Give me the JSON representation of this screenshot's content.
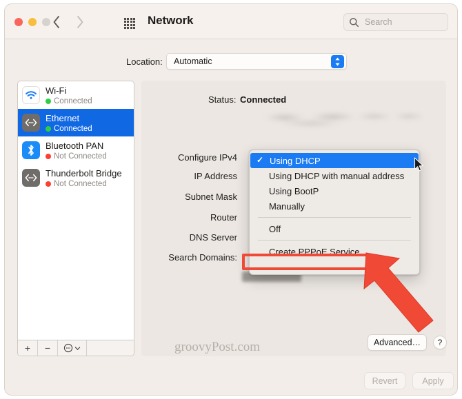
{
  "window": {
    "title": "Network",
    "traffic_lights": [
      "close",
      "minimize",
      "zoom"
    ],
    "back_label": "back",
    "forward_label": "forward",
    "grid_label": "show-all"
  },
  "search": {
    "placeholder": "Search",
    "value": ""
  },
  "location": {
    "label": "Location:",
    "value": "Automatic",
    "options": [
      "Automatic"
    ]
  },
  "sidebar": {
    "services": [
      {
        "name": "Wi-Fi",
        "status": "Connected",
        "icon": "wifi-icon",
        "connected": true,
        "selected": false
      },
      {
        "name": "Ethernet",
        "status": "Connected",
        "icon": "ethernet-icon",
        "connected": true,
        "selected": true
      },
      {
        "name": "Bluetooth PAN",
        "status": "Not Connected",
        "icon": "bluetooth-icon",
        "connected": false,
        "selected": false
      },
      {
        "name": "Thunderbolt Bridge",
        "status": "Not Connected",
        "icon": "thunderbolt-bridge-icon",
        "connected": false,
        "selected": false
      }
    ],
    "footer": {
      "add_label": "+",
      "remove_label": "−",
      "actions_label": "◯"
    }
  },
  "main": {
    "status_label": "Status:",
    "status_value": "Connected",
    "description_redacted": true,
    "fields": [
      {
        "label": "Configure IPv4",
        "value": ""
      },
      {
        "label": "IP Address",
        "value": ""
      },
      {
        "label": "Subnet Mask",
        "value": ""
      },
      {
        "label": "Router",
        "value": ""
      },
      {
        "label": "DNS Server",
        "value": ""
      },
      {
        "label": "Search Domains:",
        "value": ""
      }
    ]
  },
  "menu": {
    "items": [
      {
        "label": "Using DHCP",
        "checked": true,
        "highlighted": true,
        "separator_after": false
      },
      {
        "label": "Using DHCP with manual address",
        "checked": false,
        "highlighted": false,
        "separator_after": false
      },
      {
        "label": "Using BootP",
        "checked": false,
        "highlighted": false,
        "separator_after": false
      },
      {
        "label": "Manually",
        "checked": false,
        "highlighted": false,
        "separator_after": true
      },
      {
        "label": "Off",
        "checked": false,
        "highlighted": false,
        "separator_after": true
      },
      {
        "label": "Create PPPoE Service…",
        "checked": false,
        "highlighted": false,
        "separator_after": false
      }
    ],
    "checkmark": "✓"
  },
  "annotation": {
    "color": "#f04a36",
    "highlighted_item": "Create PPPoE Service…"
  },
  "footer": {
    "watermark": "groovyPost.com",
    "advanced_label": "Advanced…",
    "help_label": "?",
    "revert_label": "Revert",
    "apply_label": "Apply",
    "revert_enabled": false,
    "apply_enabled": false
  },
  "colors": {
    "accent": "#1b7bf2",
    "selection": "#1168e3",
    "connected": "#2fcf41",
    "disconnected": "#fa4034",
    "annotation": "#f04a36"
  }
}
